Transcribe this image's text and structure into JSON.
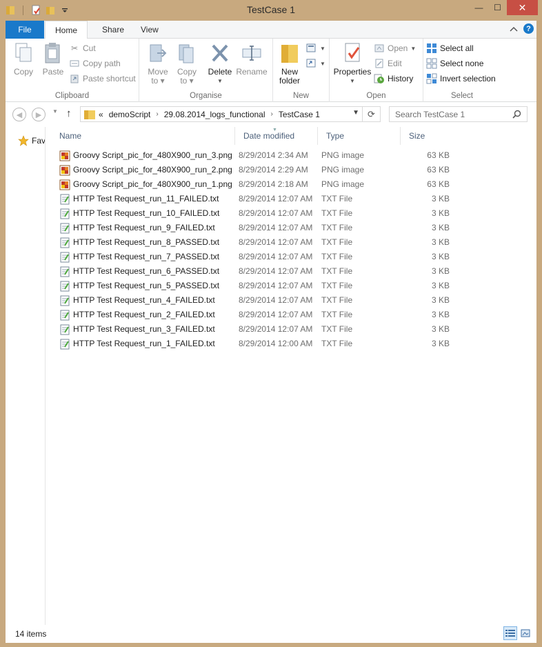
{
  "window": {
    "title": "TestCase 1",
    "controls": {
      "minimize": "—",
      "maximize": "☐",
      "close": "✕"
    }
  },
  "ribbon_tabs": {
    "file": "File",
    "home": "Home",
    "share": "Share",
    "view": "View"
  },
  "ribbon": {
    "clipboard": {
      "label": "Clipboard",
      "copy": "Copy",
      "paste": "Paste",
      "cut": "Cut",
      "copy_path": "Copy path",
      "paste_shortcut": "Paste shortcut"
    },
    "organise": {
      "label": "Organise",
      "move_to_1": "Move",
      "move_to_2": "to ▾",
      "copy_to_1": "Copy",
      "copy_to_2": "to ▾",
      "delete": "Delete",
      "rename": "Rename"
    },
    "new": {
      "label": "New",
      "new_folder_1": "New",
      "new_folder_2": "folder"
    },
    "open": {
      "label": "Open",
      "properties": "Properties",
      "open": "Open",
      "edit": "Edit",
      "history": "History"
    },
    "select": {
      "label": "Select",
      "select_all": "Select all",
      "select_none": "Select none",
      "invert_selection": "Invert selection"
    }
  },
  "address": {
    "overflow": "«",
    "crumbs": [
      "demoScript",
      "29.08.2014_logs_functional",
      "TestCase 1"
    ]
  },
  "search": {
    "placeholder": "Search TestCase 1"
  },
  "navpane": {
    "favorites": "Favourites"
  },
  "columns": {
    "name": "Name",
    "date": "Date modified",
    "type": "Type",
    "size": "Size"
  },
  "files": [
    {
      "name": "Groovy Script_pic_for_480X900_run_3.png",
      "date": "8/29/2014 2:34 AM",
      "type": "PNG image",
      "size": "63 KB",
      "kind": "png"
    },
    {
      "name": "Groovy Script_pic_for_480X900_run_2.png",
      "date": "8/29/2014 2:29 AM",
      "type": "PNG image",
      "size": "63 KB",
      "kind": "png"
    },
    {
      "name": "Groovy Script_pic_for_480X900_run_1.png",
      "date": "8/29/2014 2:18 AM",
      "type": "PNG image",
      "size": "63 KB",
      "kind": "png"
    },
    {
      "name": "HTTP Test Request_run_11_FAILED.txt",
      "date": "8/29/2014 12:07 AM",
      "type": "TXT File",
      "size": "3 KB",
      "kind": "txt"
    },
    {
      "name": "HTTP Test Request_run_10_FAILED.txt",
      "date": "8/29/2014 12:07 AM",
      "type": "TXT File",
      "size": "3 KB",
      "kind": "txt"
    },
    {
      "name": "HTTP Test Request_run_9_FAILED.txt",
      "date": "8/29/2014 12:07 AM",
      "type": "TXT File",
      "size": "3 KB",
      "kind": "txt"
    },
    {
      "name": "HTTP Test Request_run_8_PASSED.txt",
      "date": "8/29/2014 12:07 AM",
      "type": "TXT File",
      "size": "3 KB",
      "kind": "txt"
    },
    {
      "name": "HTTP Test Request_run_7_PASSED.txt",
      "date": "8/29/2014 12:07 AM",
      "type": "TXT File",
      "size": "3 KB",
      "kind": "txt"
    },
    {
      "name": "HTTP Test Request_run_6_PASSED.txt",
      "date": "8/29/2014 12:07 AM",
      "type": "TXT File",
      "size": "3 KB",
      "kind": "txt"
    },
    {
      "name": "HTTP Test Request_run_5_PASSED.txt",
      "date": "8/29/2014 12:07 AM",
      "type": "TXT File",
      "size": "3 KB",
      "kind": "txt"
    },
    {
      "name": "HTTP Test Request_run_4_FAILED.txt",
      "date": "8/29/2014 12:07 AM",
      "type": "TXT File",
      "size": "3 KB",
      "kind": "txt"
    },
    {
      "name": "HTTP Test Request_run_2_FAILED.txt",
      "date": "8/29/2014 12:07 AM",
      "type": "TXT File",
      "size": "3 KB",
      "kind": "txt"
    },
    {
      "name": "HTTP Test Request_run_3_FAILED.txt",
      "date": "8/29/2014 12:07 AM",
      "type": "TXT File",
      "size": "3 KB",
      "kind": "txt"
    },
    {
      "name": "HTTP Test Request_run_1_FAILED.txt",
      "date": "8/29/2014 12:00 AM",
      "type": "TXT File",
      "size": "3 KB",
      "kind": "txt"
    }
  ],
  "status": {
    "item_count": "14 items"
  },
  "colors": {
    "accent": "#1979ca",
    "frame": "#c8a97f",
    "close": "#c74f44"
  }
}
